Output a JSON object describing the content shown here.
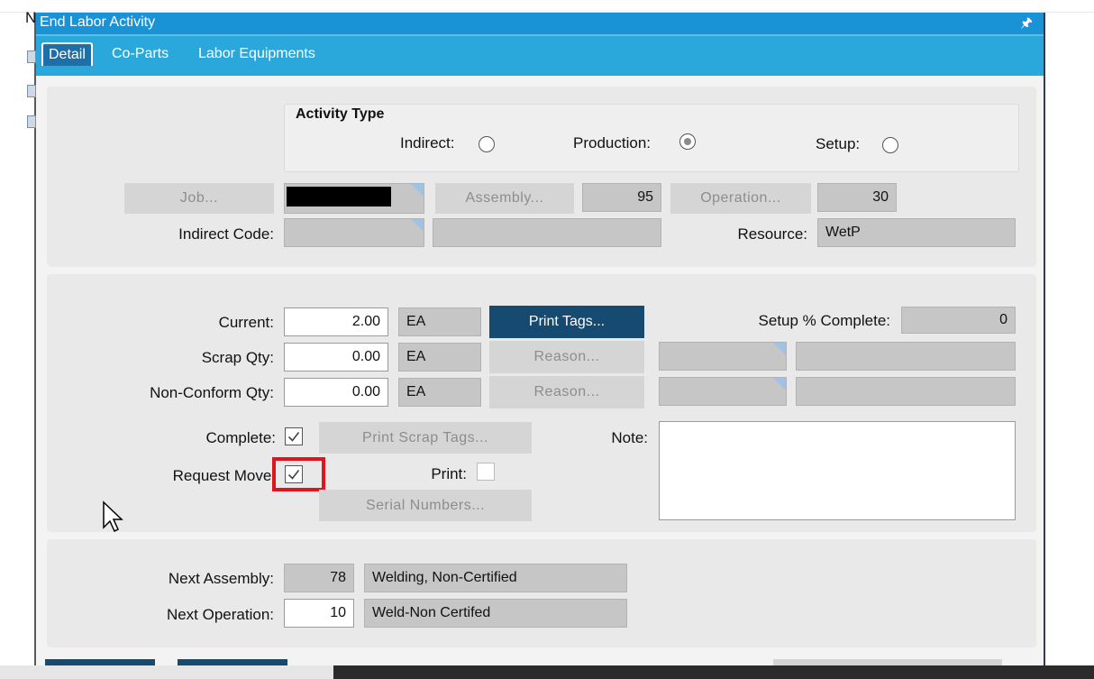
{
  "window": {
    "title": "End Labor Activity"
  },
  "tabs": [
    {
      "label": "Detail"
    },
    {
      "label": "Co-Parts"
    },
    {
      "label": "Labor Equipments"
    }
  ],
  "activity_type": {
    "title": "Activity Type",
    "indirect_label": "Indirect:",
    "production_label": "Production:",
    "setup_label": "Setup:",
    "selected": "Production"
  },
  "job": {
    "job_button": "Job...",
    "assembly_button": "Assembly...",
    "assembly_value": "95",
    "operation_button": "Operation...",
    "operation_value": "30",
    "indirect_code_label": "Indirect Code:",
    "resource_label": "Resource:",
    "resource_value": "WetP"
  },
  "quantities": {
    "current_label": "Current:",
    "current_value": "2.00",
    "current_uom": "EA",
    "print_tags_button": "Print Tags...",
    "setup_complete_label": "Setup % Complete:",
    "setup_complete_value": "0",
    "scrap_label": "Scrap Qty:",
    "scrap_value": "0.00",
    "scrap_uom": "EA",
    "scrap_reason_button": "Reason...",
    "nonconform_label": "Non-Conform Qty:",
    "nonconform_value": "0.00",
    "nonconform_uom": "EA",
    "nonconform_reason_button": "Reason..."
  },
  "flags": {
    "complete_label": "Complete:",
    "print_scrap_tags_button": "Print Scrap Tags...",
    "note_label": "Note:",
    "request_move_label": "Request Move:",
    "print_label": "Print:",
    "serial_numbers_button": "Serial Numbers..."
  },
  "next": {
    "assembly_label": "Next Assembly:",
    "assembly_value": "78",
    "assembly_desc": "Welding, Non-Certified",
    "operation_label": "Next Operation:",
    "operation_value": "10",
    "operation_desc": "Weld-Non Certifed"
  },
  "background": {
    "left_letter": "N"
  },
  "colors": {
    "title_bar": "#1a93d6",
    "tab_bar": "#2aa8dc",
    "primary_button": "#174a70",
    "highlight": "#e0141e"
  }
}
